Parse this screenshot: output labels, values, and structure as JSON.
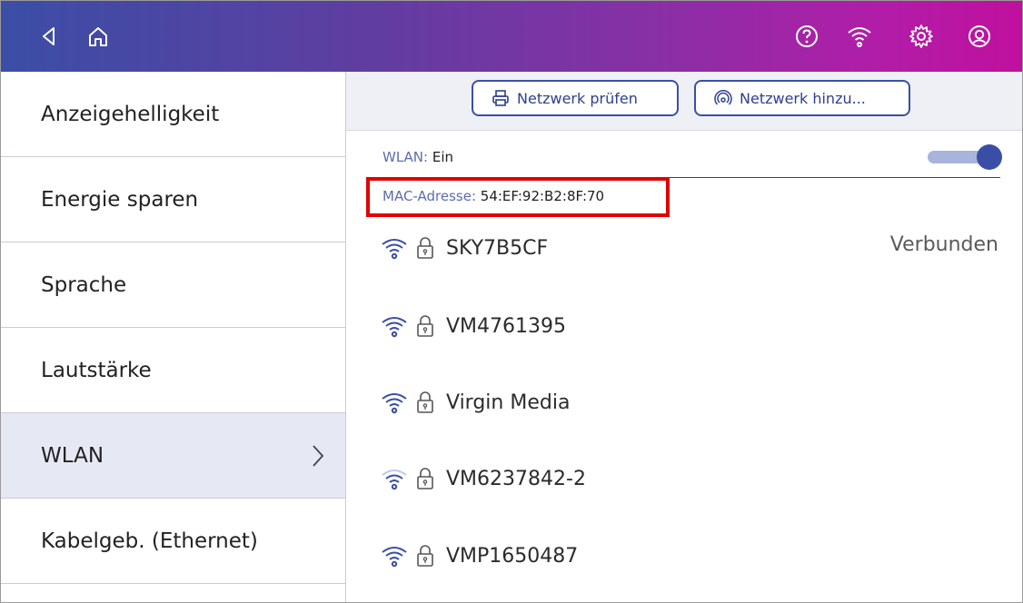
{
  "topbar": {
    "left_icons": [
      "back-arrow-icon",
      "home-icon"
    ],
    "right_icons": [
      "help-icon",
      "wifi-icon",
      "settings-gear-icon",
      "account-icon"
    ]
  },
  "sidebar": {
    "items": [
      {
        "label": "Anzeigehelligkeit",
        "active": false
      },
      {
        "label": "Energie sparen",
        "active": false
      },
      {
        "label": "Sprache",
        "active": false
      },
      {
        "label": "Lautstärke",
        "active": false
      },
      {
        "label": "WLAN",
        "active": true
      },
      {
        "label": "Kabelgeb. (Ethernet)",
        "active": false
      }
    ]
  },
  "toolbar": {
    "check_network_label": "Netzwerk prüfen",
    "add_network_label": "Netzwerk hinzu..."
  },
  "wlan": {
    "label": "WLAN:",
    "value": "Ein",
    "toggle_on": true
  },
  "mac": {
    "label": "MAC-Adresse:",
    "value": "54:EF:92:B2:8F:70"
  },
  "networks": [
    {
      "ssid": "SKY7B5CF",
      "status": "Verbunden",
      "secured": true,
      "signal": "strong"
    },
    {
      "ssid": "VM4761395",
      "status": "",
      "secured": true,
      "signal": "strong"
    },
    {
      "ssid": "Virgin Media",
      "status": "",
      "secured": true,
      "signal": "strong"
    },
    {
      "ssid": "VM6237842-2",
      "status": "",
      "secured": true,
      "signal": "medium"
    },
    {
      "ssid": "VMP1650487",
      "status": "",
      "secured": true,
      "signal": "strong"
    }
  ],
  "colors": {
    "accent": "#3b4ea6",
    "highlight_box": "#e10000",
    "gradient_start": "#3b4ea6",
    "gradient_end": "#c0109e"
  }
}
